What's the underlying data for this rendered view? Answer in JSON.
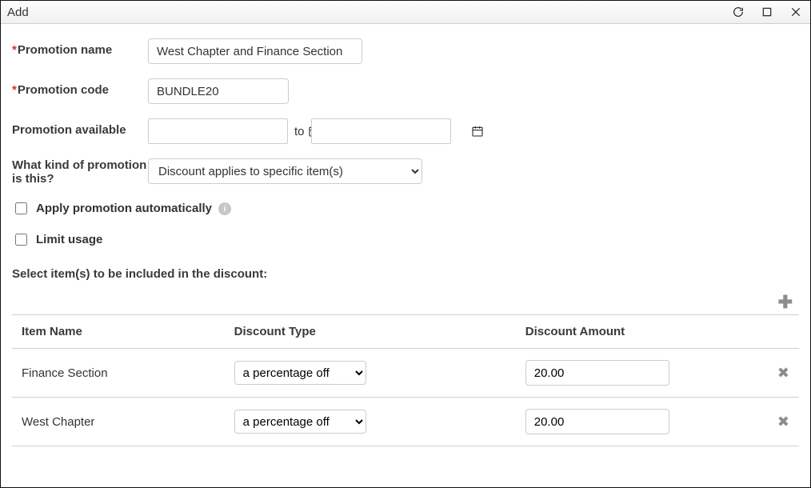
{
  "window": {
    "title": "Add"
  },
  "form": {
    "promotion_name": {
      "label": "Promotion name",
      "value": "West Chapter and Finance Section"
    },
    "promotion_code": {
      "label": "Promotion code",
      "value": "BUNDLE20"
    },
    "available": {
      "label": "Promotion available",
      "start": "",
      "end": "",
      "separator": "to"
    },
    "kind": {
      "label": "What kind of promotion is this?",
      "selected": "Discount applies to specific item(s)"
    },
    "apply_auto": {
      "label": "Apply promotion automatically",
      "checked": false
    },
    "limit_usage": {
      "label": "Limit usage",
      "checked": false
    }
  },
  "section_label": "Select item(s) to be included in the discount:",
  "table": {
    "headers": {
      "name": "Item Name",
      "type": "Discount Type",
      "amount": "Discount Amount"
    },
    "rows": [
      {
        "name": "Finance Section",
        "type": "a percentage off",
        "amount": "20.00"
      },
      {
        "name": "West Chapter",
        "type": "a percentage off",
        "amount": "20.00"
      }
    ]
  }
}
